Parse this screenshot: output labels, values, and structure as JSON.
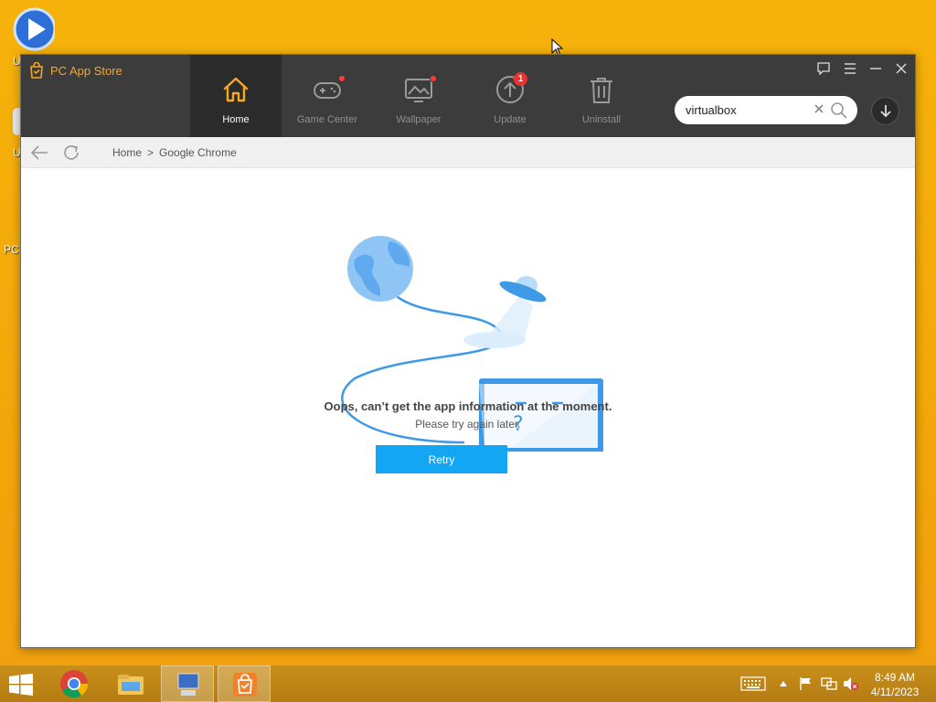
{
  "desktop": {
    "icon_labels": [
      "U",
      "U",
      "PC"
    ]
  },
  "app": {
    "title": "PC App Store",
    "nav": [
      {
        "label": "Home",
        "active": true,
        "icon": "home-icon"
      },
      {
        "label": "Game Center",
        "icon": "gamepad-icon",
        "dot": true
      },
      {
        "label": "Wallpaper",
        "icon": "wallpaper-icon",
        "dot": true
      },
      {
        "label": "Update",
        "icon": "update-icon",
        "badge": "1"
      },
      {
        "label": "Uninstall",
        "icon": "trash-icon"
      }
    ],
    "search": {
      "value": "virtualbox"
    },
    "breadcrumb": {
      "home": "Home",
      "separator": ">",
      "current": "Google Chrome"
    },
    "error": {
      "title": "Oops, can’t get the app information at the moment.",
      "subtitle": "Please try again later.",
      "retry_label": "Retry",
      "laptop_glyph": "?"
    }
  },
  "taskbar": {
    "time": "8:49 AM",
    "date": "4/11/2023"
  },
  "colors": {
    "accent": "#f5a623",
    "titlebar": "#3c3c3c",
    "retry": "#13a6f5",
    "illustration_blue": "#3e9ae6"
  }
}
